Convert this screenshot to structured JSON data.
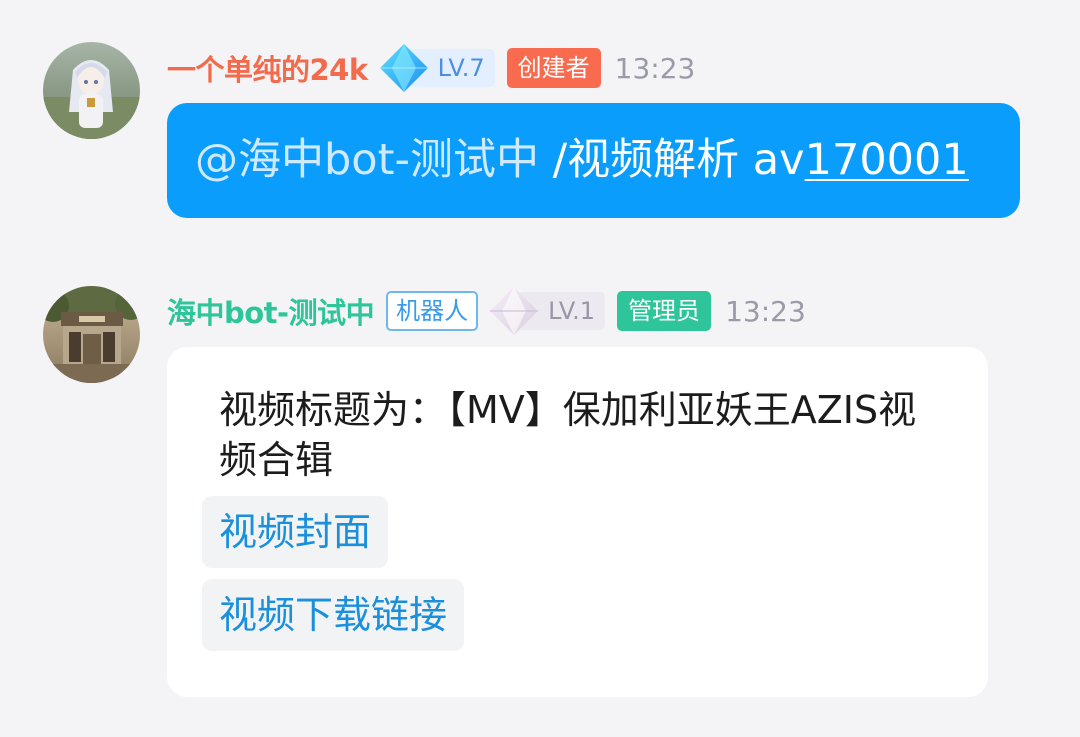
{
  "messages": [
    {
      "sender": "一个单纯的24k",
      "level": "LV.7",
      "role": "创建者",
      "time": "13:23",
      "content": {
        "mention": "@海中bot-测试中",
        "command": " /视频解析 av",
        "link": "170001"
      }
    },
    {
      "sender": "海中bot-测试中",
      "bot_tag": "机器人",
      "level": "LV.1",
      "role": "管理员",
      "time": "13:23",
      "content": {
        "text": "视频标题为：【MV】保加利亚妖王AZIS视频合辑",
        "buttons": [
          "视频封面",
          "视频下载链接"
        ]
      }
    }
  ],
  "colors": {
    "background": "#f4f4f6",
    "sender1": "#f26b4d",
    "sender2": "#2fc59a",
    "creator_tag": "#f86b4e",
    "admin_tag": "#2fc59a",
    "bubble_blue": "#0a9dfb",
    "link_text": "#1a8fdc"
  },
  "icons": {
    "level7_badge": "blue-diamond-icon",
    "level1_badge": "pale-diamond-icon"
  }
}
